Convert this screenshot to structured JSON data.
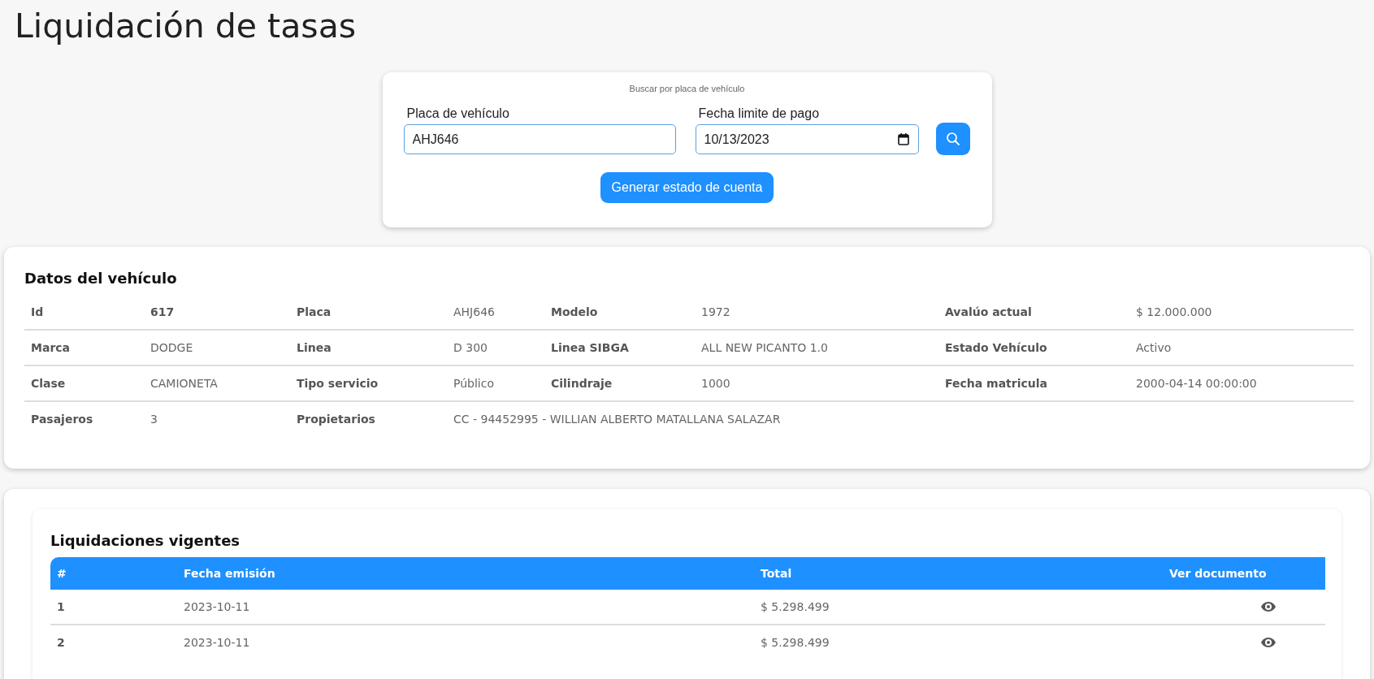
{
  "page_title": "Liquidación de tasas",
  "search": {
    "caption": "Buscar por placa de vehículo",
    "plate_label": "Placa de vehículo",
    "plate_value": "AHJ646",
    "date_label": "Fecha limite de pago",
    "date_value": "10/13/2023",
    "generate_button": "Generar estado de cuenta"
  },
  "vehicle": {
    "title": "Datos del vehículo",
    "rows": [
      [
        {
          "label": "Id",
          "value": "617",
          "emphasized": true
        },
        {
          "label": "Placa",
          "value": "AHJ646",
          "emphasized": false
        },
        {
          "label": "Modelo",
          "value": "1972",
          "emphasized": false
        },
        {
          "label": "Avalúo actual",
          "value": "$ 12.000.000",
          "emphasized": false
        }
      ],
      [
        {
          "label": "Marca",
          "value": "DODGE",
          "emphasized": false
        },
        {
          "label": "Linea",
          "value": "D 300",
          "emphasized": false
        },
        {
          "label": "Linea SIBGA",
          "value": "ALL NEW PICANTO 1.0",
          "emphasized": false
        },
        {
          "label": "Estado Vehículo",
          "value": "Activo",
          "emphasized": false
        }
      ],
      [
        {
          "label": "Clase",
          "value": "CAMIONETA",
          "emphasized": false
        },
        {
          "label": "Tipo servicio",
          "value": "Público",
          "emphasized": false
        },
        {
          "label": "Cilindraje",
          "value": "1000",
          "emphasized": false
        },
        {
          "label": "Fecha matricula",
          "value": "2000-04-14 00:00:00",
          "emphasized": false
        }
      ],
      [
        {
          "label": "Pasajeros",
          "value": "3",
          "emphasized": false
        },
        {
          "label": "Propietarios",
          "value": "CC - 94452995 - WILLIAN ALBERTO MATALLANA SALAZAR",
          "emphasized": false
        }
      ]
    ]
  },
  "liquidations": {
    "title": "Liquidaciones vigentes",
    "columns": [
      "#",
      "Fecha emisión",
      "Total",
      "Ver documento"
    ],
    "rows": [
      {
        "number": "1",
        "date": "2023-10-11",
        "total": "$ 5.298.499"
      },
      {
        "number": "2",
        "date": "2023-10-11",
        "total": "$ 5.298.499"
      }
    ]
  }
}
